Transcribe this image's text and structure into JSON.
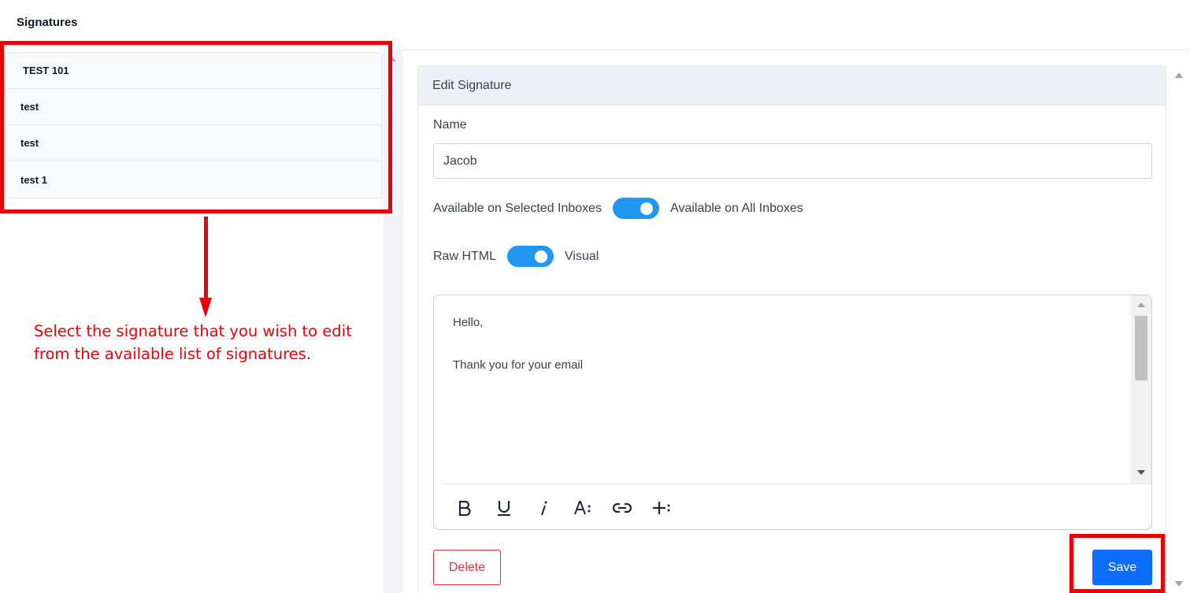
{
  "page": {
    "title": "Signatures"
  },
  "signatures": {
    "items": [
      {
        "label": "TEST 101"
      },
      {
        "label": "test"
      },
      {
        "label": "test"
      },
      {
        "label": "test 1"
      }
    ]
  },
  "annotation": {
    "text": "Select the signature that you wish to edit from the available list of signatures.",
    "color": "#e8000b"
  },
  "edit": {
    "header": "Edit Signature",
    "name_label": "Name",
    "name_value": "Jacob",
    "inbox_toggle": {
      "left_label": "Available on Selected Inboxes",
      "right_label": "Available on All Inboxes",
      "on": true
    },
    "mode_toggle": {
      "left_label": "Raw HTML",
      "right_label": "Visual",
      "on": true
    },
    "editor": {
      "line1": "Hello,",
      "line2": "Thank you for your email"
    },
    "toolbar": [
      "bold-icon",
      "underline-icon",
      "italic-icon",
      "font-size-icon",
      "link-icon",
      "insert-more-icon"
    ],
    "delete_label": "Delete",
    "save_label": "Save"
  },
  "colors": {
    "accent": "#2196f3",
    "primary_button": "#0d6efd",
    "danger": "#dc3545"
  }
}
